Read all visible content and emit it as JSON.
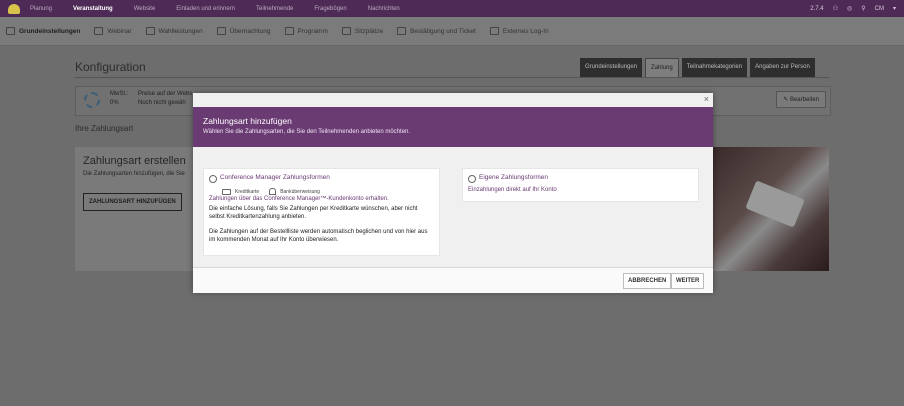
{
  "topnav": {
    "items": [
      "Planung",
      "Veranstaltung",
      "Website",
      "Einladen und erinnern",
      "Teilnehmende",
      "Fragebögen",
      "Nachrichten"
    ],
    "active_index": 1,
    "right": {
      "count": "2.7.4",
      "avatar": "CM"
    }
  },
  "subnav": {
    "items": [
      "Grundeinstellungen",
      "Webinar",
      "Wahlleistungen",
      "Übernachtung",
      "Programm",
      "Sitzplätze",
      "Bestätigung und Ticket",
      "Externes Log-In"
    ]
  },
  "page": {
    "title": "Konfiguration",
    "tabs": [
      "Grundeinstellungen",
      "Zahlung",
      "Teilnahmekategorien",
      "Angaben zur Person"
    ],
    "active_tab": "Zahlung",
    "mwst_label": "MwSt.:",
    "mwst_value": "0%",
    "preise_line1": "Preise auf der Webs",
    "preise_line2": "Noch nicht gewäh",
    "bearbeiten": "Bearbeiten",
    "section_title": "Ihre Zahlungsart",
    "create_title": "Zahlungsart erstellen",
    "create_text": "Die Zahlungsarten hinzufügen, die Sie",
    "create_button": "ZAHLUNGSART HINZUFÜGEN"
  },
  "modal": {
    "title": "Zahlungsart hinzufügen",
    "subtitle": "Wählen Sie die Zahlungsarten, die Sie den Teilnehmenden anbieten möchten.",
    "close": "×",
    "option1": {
      "title": "Conference Manager Zahlungsformen",
      "icon1_label": "Kreditkarte",
      "icon2_label": "Banküberweisung",
      "link": "Zahlungen über das Conference Manager™-Kundenkonto erhalten.",
      "text1": "Die einfache Lösung, falls Sie Zahlungen per Kreditkarte wünschen, aber nicht selbst Kreditkartenzahlung anbieten.",
      "text2": "Die Zahlungen auf der Bestellliste werden automatisch beglichen und von hier aus im kommenden Monat auf Ihr Konto überwiesen."
    },
    "option2": {
      "title": "Eigene Zahlungsformen",
      "link": "Einzahlungen direkt auf Ihr Konto"
    },
    "cancel_label": "ABBRECHEN",
    "next_label": "WEITER"
  }
}
